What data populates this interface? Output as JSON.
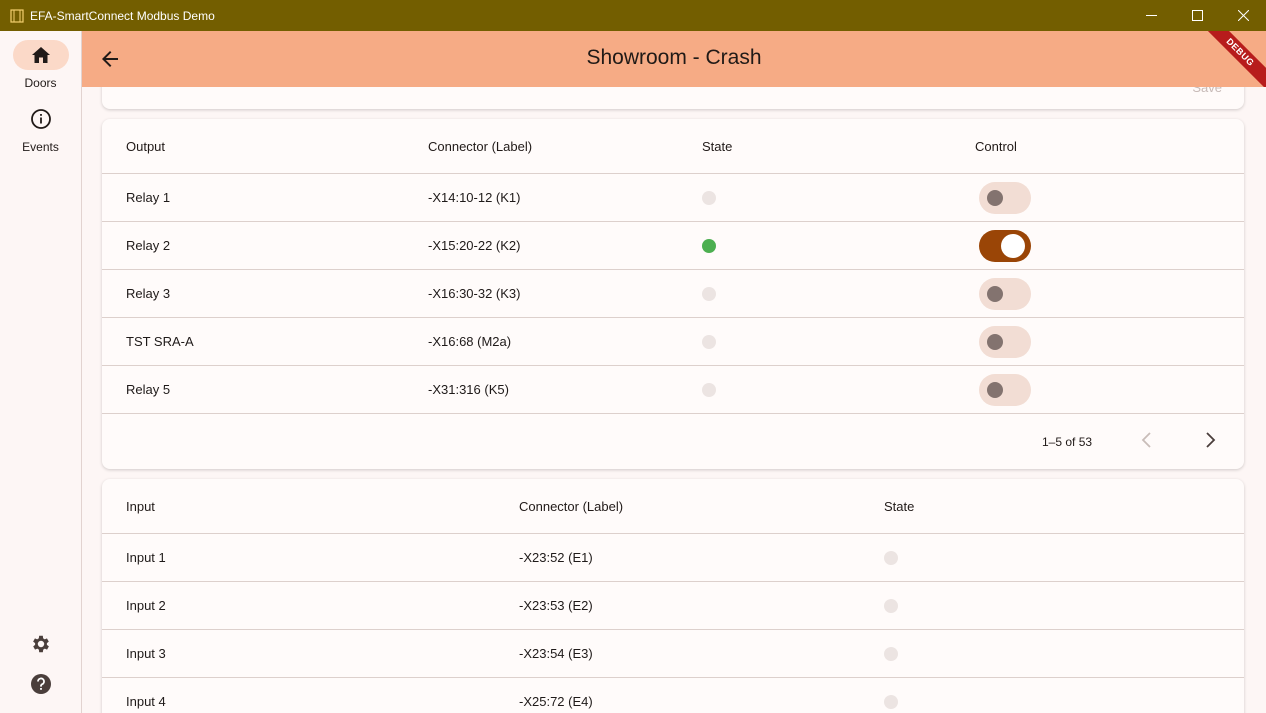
{
  "window": {
    "title": "EFA-SmartConnect Modbus Demo"
  },
  "rail": {
    "items": [
      {
        "label": "Doors",
        "icon": "home-icon",
        "active": true
      },
      {
        "label": "Events",
        "icon": "info-icon",
        "active": false
      }
    ],
    "bottom_icons": [
      "settings-icon",
      "help-icon"
    ]
  },
  "appbar": {
    "title": "Showroom - Crash",
    "debug_banner": "DEBUG"
  },
  "top_card": {
    "save_label": "Save"
  },
  "outputs": {
    "columns": [
      "Output",
      "Connector (Label)",
      "State",
      "Control"
    ],
    "rows": [
      {
        "name": "Relay 1",
        "connector": "-X14:10-12 (K1)",
        "state": false,
        "control": false
      },
      {
        "name": "Relay 2",
        "connector": "-X15:20-22 (K2)",
        "state": true,
        "control": true
      },
      {
        "name": "Relay 3",
        "connector": "-X16:30-32 (K3)",
        "state": false,
        "control": false
      },
      {
        "name": "TST SRA-A",
        "connector": "-X16:68 (M2a)",
        "state": false,
        "control": false
      },
      {
        "name": "Relay 5",
        "connector": "-X31:316 (K5)",
        "state": false,
        "control": false
      }
    ],
    "pagination": "1–5 of 53"
  },
  "inputs": {
    "columns": [
      "Input",
      "Connector (Label)",
      "State"
    ],
    "rows": [
      {
        "name": "Input 1",
        "connector": "-X23:52 (E1)",
        "state": false
      },
      {
        "name": "Input 2",
        "connector": "-X23:53 (E2)",
        "state": false
      },
      {
        "name": "Input 3",
        "connector": "-X23:54 (E3)",
        "state": false
      },
      {
        "name": "Input 4",
        "connector": "-X25:72 (E4)",
        "state": false
      }
    ]
  },
  "colors": {
    "titlebar": "#735e00",
    "appbar": "#f6ab85",
    "state_on": "#4caf50",
    "switch_on": "#9a4506"
  }
}
